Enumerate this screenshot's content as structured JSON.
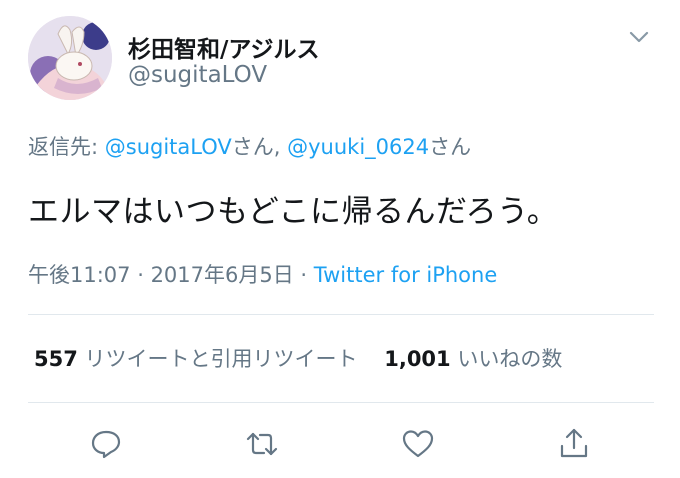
{
  "author": {
    "display_name": "杉田智和/アジルス",
    "handle": "@sugitaLOV"
  },
  "reply": {
    "prefix": "返信先: ",
    "mentions": [
      {
        "handle": "@sugitaLOV",
        "suffix": "さん"
      },
      {
        "handle": "@yuuki_0624",
        "suffix": "さん"
      }
    ],
    "separator": ", "
  },
  "tweet": {
    "text": "エルマはいつもどこに帰るんだろう。"
  },
  "meta": {
    "time": "午後11:07",
    "dot": " · ",
    "date": "2017年6月5日",
    "source": "Twitter for iPhone"
  },
  "stats": {
    "retweets_count": "557",
    "retweets_label": "リツイートと引用リツイート",
    "likes_count": "1,001",
    "likes_label": "いいねの数"
  },
  "icons": {
    "menu": "chevron-down-icon",
    "reply": "reply-bubble-icon",
    "retweet": "retweet-icon",
    "like": "heart-icon",
    "share": "share-icon"
  },
  "colors": {
    "link": "#1da1f2",
    "secondary": "#657786",
    "text": "#14171a",
    "divider": "#e1e8ed"
  }
}
